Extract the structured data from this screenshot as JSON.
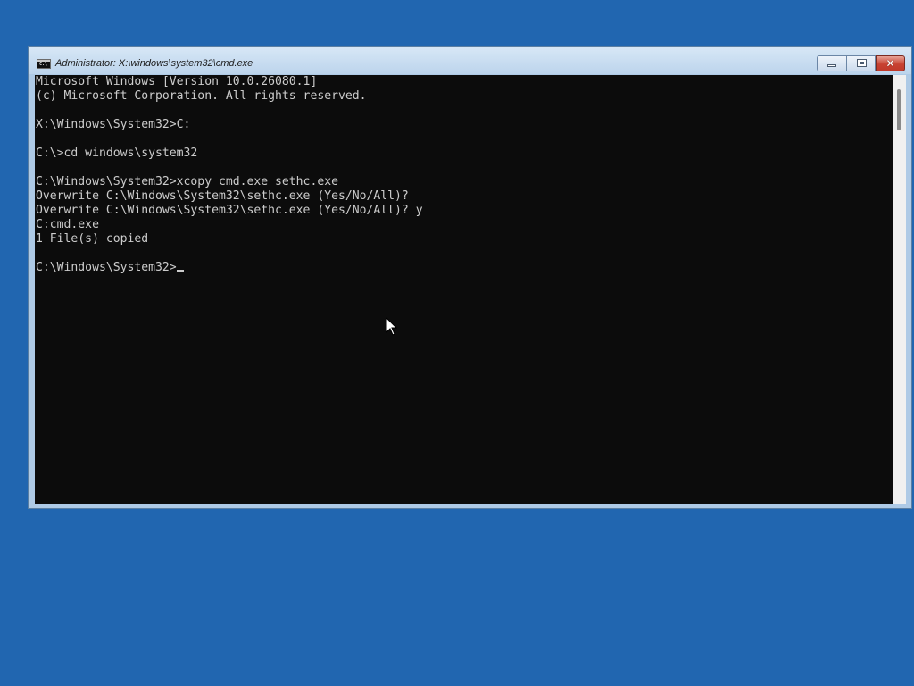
{
  "window": {
    "title": "Administrator: X:\\windows\\system32\\cmd.exe",
    "icon": "cmd-icon",
    "buttons": {
      "minimize": "minimize-icon",
      "maximize": "maximize-icon",
      "close": "close-icon",
      "close_glyph": "✕"
    },
    "icon_text": "C:\\"
  },
  "console": {
    "lines": [
      "Microsoft Windows [Version 10.0.26080.1]",
      "(c) Microsoft Corporation. All rights reserved.",
      "",
      "X:\\Windows\\System32>C:",
      "",
      "C:\\>cd windows\\system32",
      "",
      "C:\\Windows\\System32>xcopy cmd.exe sethc.exe",
      "Overwrite C:\\Windows\\System32\\sethc.exe (Yes/No/All)?",
      "Overwrite C:\\Windows\\System32\\sethc.exe (Yes/No/All)? y",
      "C:cmd.exe",
      "1 File(s) copied",
      "",
      "C:\\Windows\\System32>"
    ],
    "text_color": "#cccccc",
    "background": "#0c0c0c"
  },
  "desktop": {
    "background": "#2166b0"
  }
}
